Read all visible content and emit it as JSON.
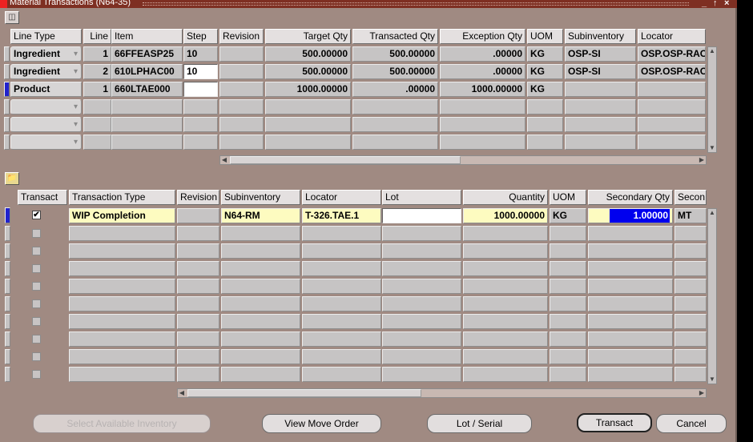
{
  "window": {
    "title": "Material Transactions (N64-35)",
    "controls": [
      "_",
      "↑",
      "×"
    ]
  },
  "top_table": {
    "columns": [
      "Line Type",
      "Line",
      "Item",
      "Step",
      "Revision",
      "Target Qty",
      "Transacted Qty",
      "Exception Qty",
      "UOM",
      "Subinventory",
      "Locator"
    ],
    "rows": [
      {
        "line_type": "Ingredient",
        "line": "1",
        "item": "66FFEASP25",
        "step": "10",
        "revision": "",
        "target_qty": "500.00000",
        "transacted_qty": "500.00000",
        "exception_qty": ".00000",
        "uom": "KG",
        "subinventory": "OSP-SI",
        "locator": "OSP.OSP-RAC"
      },
      {
        "line_type": "Ingredient",
        "line": "2",
        "item": "610LPHAC00",
        "step": "10",
        "revision": "",
        "target_qty": "500.00000",
        "transacted_qty": "500.00000",
        "exception_qty": ".00000",
        "uom": "KG",
        "subinventory": "OSP-SI",
        "locator": "OSP.OSP-RAC"
      },
      {
        "line_type": "Product",
        "line": "1",
        "item": "660LTAE000",
        "step": "",
        "revision": "",
        "target_qty": "1000.00000",
        "transacted_qty": ".00000",
        "exception_qty": "1000.00000",
        "uom": "KG",
        "subinventory": "",
        "locator": ""
      }
    ]
  },
  "bottom_table": {
    "columns": [
      "Transact",
      "Transaction Type",
      "Revision",
      "Subinventory",
      "Locator",
      "Lot",
      "Quantity",
      "UOM",
      "Secondary Qty",
      "Secon"
    ],
    "rows": [
      {
        "transact": "✔",
        "transaction_type": "WIP Completion",
        "revision": "",
        "subinventory": "N64-RM",
        "locator": "T-326.TAE.1",
        "lot": "",
        "quantity": "1000.00000",
        "uom": "KG",
        "secondary_qty": "1.00000",
        "secondary_uom": "MT"
      }
    ]
  },
  "buttons": {
    "select_inventory": "Select Available Inventory",
    "view_move_order": "View Move Order",
    "lot_serial": "Lot / Serial",
    "transact": "Transact",
    "cancel": "Cancel"
  }
}
